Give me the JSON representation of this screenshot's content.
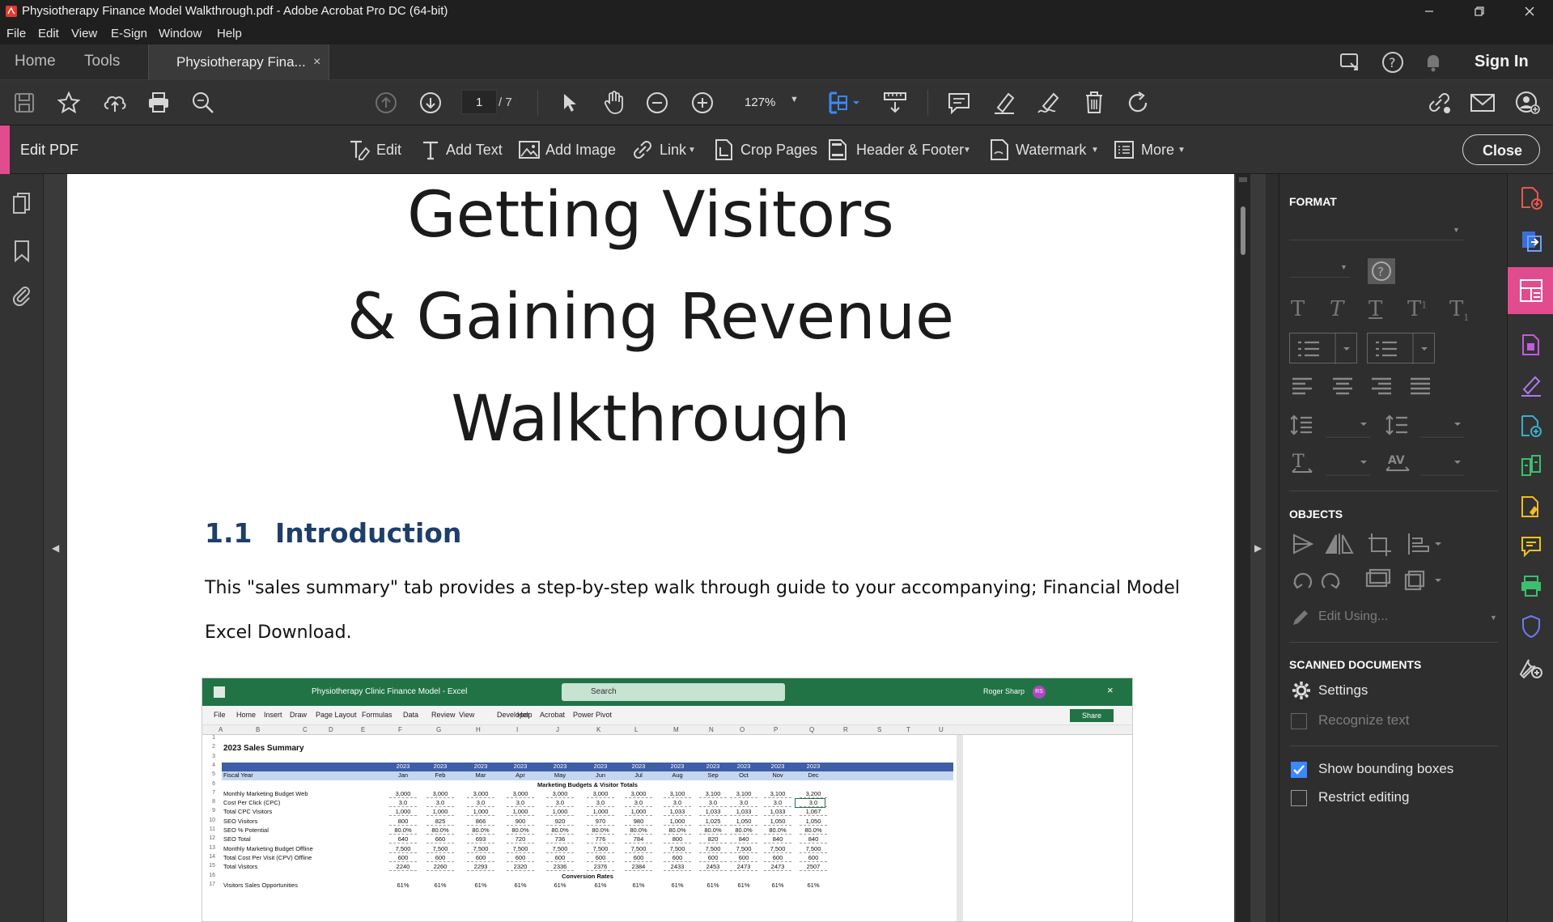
{
  "window": {
    "title": "Physiotherapy Finance Model Walkthrough.pdf - Adobe Acrobat Pro DC (64-bit)"
  },
  "menu": [
    "File",
    "Edit",
    "View",
    "E-Sign",
    "Window",
    "Help"
  ],
  "tabs": {
    "home": "Home",
    "tools": "Tools",
    "doc": "Physiotherapy Fina...",
    "sign_in": "Sign In"
  },
  "toolbar": {
    "page_current": "1",
    "page_total": "/ 7",
    "zoom": "127%"
  },
  "edit_bar": {
    "title": "Edit PDF",
    "edit": "Edit",
    "add_text": "Add Text",
    "add_image": "Add Image",
    "link": "Link",
    "crop_pages": "Crop Pages",
    "header_footer": "Header & Footer",
    "watermark": "Watermark",
    "more": "More",
    "close": "Close"
  },
  "document": {
    "title_lines": [
      "Getting Visitors",
      "& Gaining Revenue",
      "Walkthrough"
    ],
    "section_number": "1.1",
    "section_title": "Introduction",
    "body": "This \"sales summary\" tab provides a step-by-step walk through guide to your accompanying; Financial Model Excel Download."
  },
  "excel": {
    "title": "Physiotherapy Clinic Finance Model - Excel",
    "search": "Search",
    "user": "Roger Sharp",
    "initials": "RS",
    "share": "Share",
    "ribbon": [
      "File",
      "Home",
      "Insert",
      "Draw",
      "Page Layout",
      "Formulas",
      "Data",
      "Review",
      "View",
      "Developer",
      "Help",
      "Acrobat",
      "Power Pivot"
    ],
    "columns": [
      "A",
      "B",
      "C",
      "D",
      "E",
      "F",
      "G",
      "H",
      "I",
      "J",
      "K",
      "L",
      "M",
      "N",
      "O",
      "P",
      "Q",
      "R",
      "S",
      "T",
      "U"
    ],
    "sheet_title": "2023 Sales Summary",
    "year_row": [
      "2023",
      "2023",
      "2023",
      "2023",
      "2023",
      "2023",
      "2023",
      "2023",
      "2023",
      "2023",
      "2023",
      "2023"
    ],
    "fiscal_label": "Fiscal Year",
    "months": [
      "Jan",
      "Feb",
      "Mar",
      "Apr",
      "May",
      "Jun",
      "Jul",
      "Aug",
      "Sep",
      "Oct",
      "Nov",
      "Dec"
    ],
    "section_header": "Marketing Budgets & Visitor Totals",
    "conversion_header": "Conversion Rates",
    "rows": [
      {
        "n": "7",
        "label": "Monthly Marketing Budget Web",
        "v": [
          "3,000",
          "3,000",
          "3,000",
          "3,000",
          "3,000",
          "3,000",
          "3,000",
          "3,100",
          "3,100",
          "3,100",
          "3,100",
          "3,200"
        ]
      },
      {
        "n": "8",
        "label": "Cost Per Click (CPC)",
        "v": [
          "3.0",
          "3.0",
          "3.0",
          "3.0",
          "3.0",
          "3.0",
          "3.0",
          "3.0",
          "3.0",
          "3.0",
          "3.0",
          "3.0"
        ]
      },
      {
        "n": "9",
        "label": "Total CPC Visitors",
        "v": [
          "1,000",
          "1,000",
          "1,000",
          "1,000",
          "1,000",
          "1,000",
          "1,000",
          "1,033",
          "1,033",
          "1,033",
          "1,033",
          "1,067"
        ]
      },
      {
        "n": "10",
        "label": "SEO Visitors",
        "v": [
          "800",
          "825",
          "866",
          "900",
          "920",
          "970",
          "980",
          "1,000",
          "1,025",
          "1,050",
          "1,050",
          "1,050"
        ]
      },
      {
        "n": "11",
        "label": "SEO % Potential",
        "v": [
          "80.0%",
          "80.0%",
          "80.0%",
          "80.0%",
          "80.0%",
          "80.0%",
          "80.0%",
          "80.0%",
          "80.0%",
          "80.0%",
          "80.0%",
          "80.0%"
        ]
      },
      {
        "n": "12",
        "label": "SEO Total",
        "v": [
          "640",
          "660",
          "693",
          "720",
          "736",
          "776",
          "784",
          "800",
          "820",
          "840",
          "840",
          "840"
        ]
      },
      {
        "n": "13",
        "label": "Monthly Marketing Budget Offline",
        "v": [
          "7,500",
          "7,500",
          "7,500",
          "7,500",
          "7,500",
          "7,500",
          "7,500",
          "7,500",
          "7,500",
          "7,500",
          "7,500",
          "7,500"
        ]
      },
      {
        "n": "14",
        "label": "Total Cost Per Visit (CPV) Offline",
        "v": [
          "600",
          "600",
          "600",
          "600",
          "600",
          "600",
          "600",
          "600",
          "600",
          "600",
          "600",
          "600"
        ]
      },
      {
        "n": "15",
        "label": "Total Visitors",
        "v": [
          "2240",
          "2260",
          "2293",
          "2320",
          "2336",
          "2376",
          "2384",
          "2433",
          "2453",
          "2473",
          "2473",
          "2507"
        ]
      }
    ],
    "last_row": {
      "n": "17",
      "label": "Visitors Sales Opportunities",
      "v": [
        "61%",
        "61%",
        "61%",
        "61%",
        "61%",
        "61%",
        "61%",
        "61%",
        "61%",
        "61%",
        "61%",
        "61%"
      ]
    }
  },
  "right_panel": {
    "format": "FORMAT",
    "objects": "OBJECTS",
    "edit_using": "Edit Using...",
    "scanned": "SCANNED DOCUMENTS",
    "settings": "Settings",
    "recognize": "Recognize text",
    "show_bbox": "Show bounding boxes",
    "restrict": "Restrict editing"
  },
  "colors": {
    "accent_pink": "#e14c8f",
    "excel_green": "#217346",
    "blue_check": "#3b88ff"
  }
}
